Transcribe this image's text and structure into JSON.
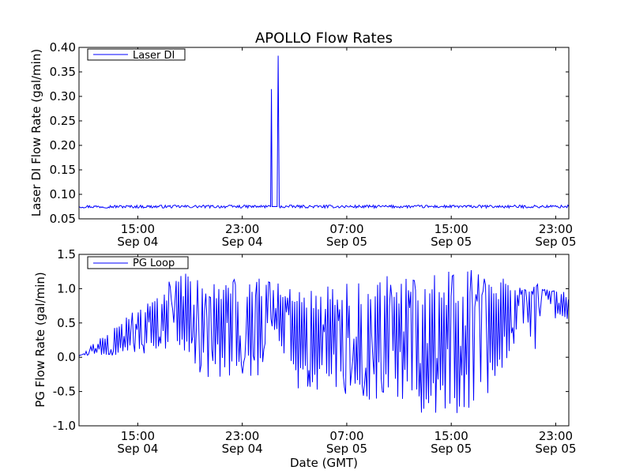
{
  "figure": {
    "title": "APOLLO Flow Rates"
  },
  "colors": {
    "series": "#0000ff",
    "frame": "#000000",
    "background": "#ffffff"
  },
  "chart_data": [
    {
      "type": "line",
      "title": "APOLLO Flow Rates",
      "xlabel": "",
      "ylabel": "Laser DI Flow Rate (gal/min)",
      "xlim": [
        "Sep 04 10:30",
        "Sep 06 00:00"
      ],
      "ylim": [
        0.05,
        0.4
      ],
      "yticks": [
        "0.05",
        "0.10",
        "0.15",
        "0.20",
        "0.25",
        "0.30",
        "0.35",
        "0.40"
      ],
      "xticks": [
        {
          "time": "15:00",
          "date": "Sep 04"
        },
        {
          "time": "23:00",
          "date": "Sep 04"
        },
        {
          "time": "07:00",
          "date": "Sep 05"
        },
        {
          "time": "15:00",
          "date": "Sep 05"
        },
        {
          "time": "23:00",
          "date": "Sep 05"
        }
      ],
      "grid": false,
      "legend": "top-left",
      "series": [
        {
          "name": "Laser DI",
          "x": [
            "Sep 04 10:30",
            "Sep 05 01:10",
            "Sep 05 01:14",
            "Sep 05 01:17",
            "Sep 05 01:40",
            "Sep 05 01:45",
            "Sep 05 01:50",
            "Sep 06 00:00"
          ],
          "y": [
            0.075,
            0.075,
            0.315,
            0.075,
            0.075,
            0.383,
            0.075,
            0.075
          ]
        }
      ]
    },
    {
      "type": "line",
      "xlabel": "Date (GMT)",
      "ylabel": "PG Flow Rate (gal/min)",
      "xlim": [
        "Sep 04 10:30",
        "Sep 06 00:00"
      ],
      "ylim": [
        -1.0,
        1.5
      ],
      "yticks": [
        "-1.0",
        "-0.5",
        "0.0",
        "0.5",
        "1.0",
        "1.5"
      ],
      "xticks": [
        {
          "time": "15:00",
          "date": "Sep 04"
        },
        {
          "time": "23:00",
          "date": "Sep 04"
        },
        {
          "time": "07:00",
          "date": "Sep 05"
        },
        {
          "time": "15:00",
          "date": "Sep 05"
        },
        {
          "time": "23:00",
          "date": "Sep 05"
        }
      ],
      "grid": false,
      "legend": "top-left",
      "series": [
        {
          "name": "PG Loop",
          "x": [
            "Sep 04 10:30",
            "Sep 04 18:15",
            "Sep 04 20:15",
            "Sep 04 20:30",
            "Sep 04 22:00",
            "Sep 04 23:30",
            "Sep 05 00:30",
            "Sep 05 01:00",
            "Sep 05 03:00",
            "Sep 05 06:00",
            "Sep 05 09:00",
            "Sep 05 12:00",
            "Sep 05 15:00",
            "Sep 05 18:00",
            "Sep 05 20:30",
            "Sep 05 21:30",
            "Sep 05 22:00",
            "Sep 05 23:00",
            "Sep 06 00:00"
          ],
          "max": [
            0.02,
            1.25,
            1.22,
            1.15,
            1.2,
            1.15,
            1.2,
            1.1,
            1.05,
            1.05,
            1.15,
            1.25,
            1.3,
            1.25,
            1.0,
            1.15,
            1.0,
            1.0,
            0.95
          ],
          "min": [
            0.02,
            0.02,
            -0.3,
            -0.35,
            -0.35,
            -0.35,
            -0.35,
            0.6,
            -0.45,
            -0.5,
            -0.65,
            -0.8,
            -0.85,
            -0.6,
            0.5,
            0.05,
            0.98,
            0.55,
            0.5
          ]
        }
      ]
    }
  ]
}
